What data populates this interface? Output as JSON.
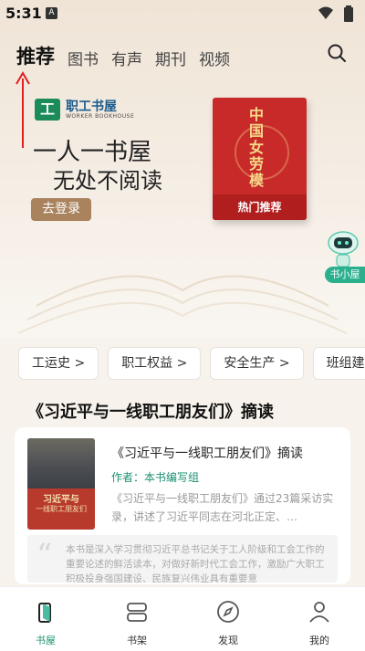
{
  "status_bar": {
    "time": "5:31",
    "sim_badge": "A"
  },
  "top_nav": {
    "tabs": [
      "推荐",
      "图书",
      "有声",
      "期刊",
      "视频"
    ],
    "active": "推荐"
  },
  "banner": {
    "brand_cn": "职工书屋",
    "brand_en": "WORKER BOOKHOUSE",
    "slogan_line1": "一人一书屋",
    "slogan_line2": "无处不阅读",
    "login_label": "去登录",
    "featured_book_title": "中国女劳模",
    "featured_label": "热门推荐"
  },
  "mascot": {
    "label": "书小屋"
  },
  "category_chips": [
    "工运史 >",
    "职工权益 >",
    "安全生产 >",
    "班组建设"
  ],
  "section": {
    "title": "《习近平与一线职工朋友们》摘读",
    "card": {
      "cover_title": "习近平与",
      "cover_subtitle": "一线职工朋友们",
      "book_title": "《习近平与一线职工朋友们》摘读",
      "author": "作者：本书编写组",
      "description": "《习近平与一线职工朋友们》通过23篇采访实录，讲述了习近平同志在河北正定、…",
      "quote": "本书是深入学习贯彻习近平总书记关于工人阶级和工会工作的重要论述的鲜活读本，对做好新时代工会工作，激励广大职工积极投身强国建设、民族复兴伟业具有重要意"
    }
  },
  "bottom_nav": {
    "items": [
      "书屋",
      "书架",
      "发现",
      "我的"
    ],
    "active": "书屋"
  },
  "colors": {
    "accent": "#1a8f71",
    "annotation": "#e02020",
    "login_button": "#a9825e"
  }
}
